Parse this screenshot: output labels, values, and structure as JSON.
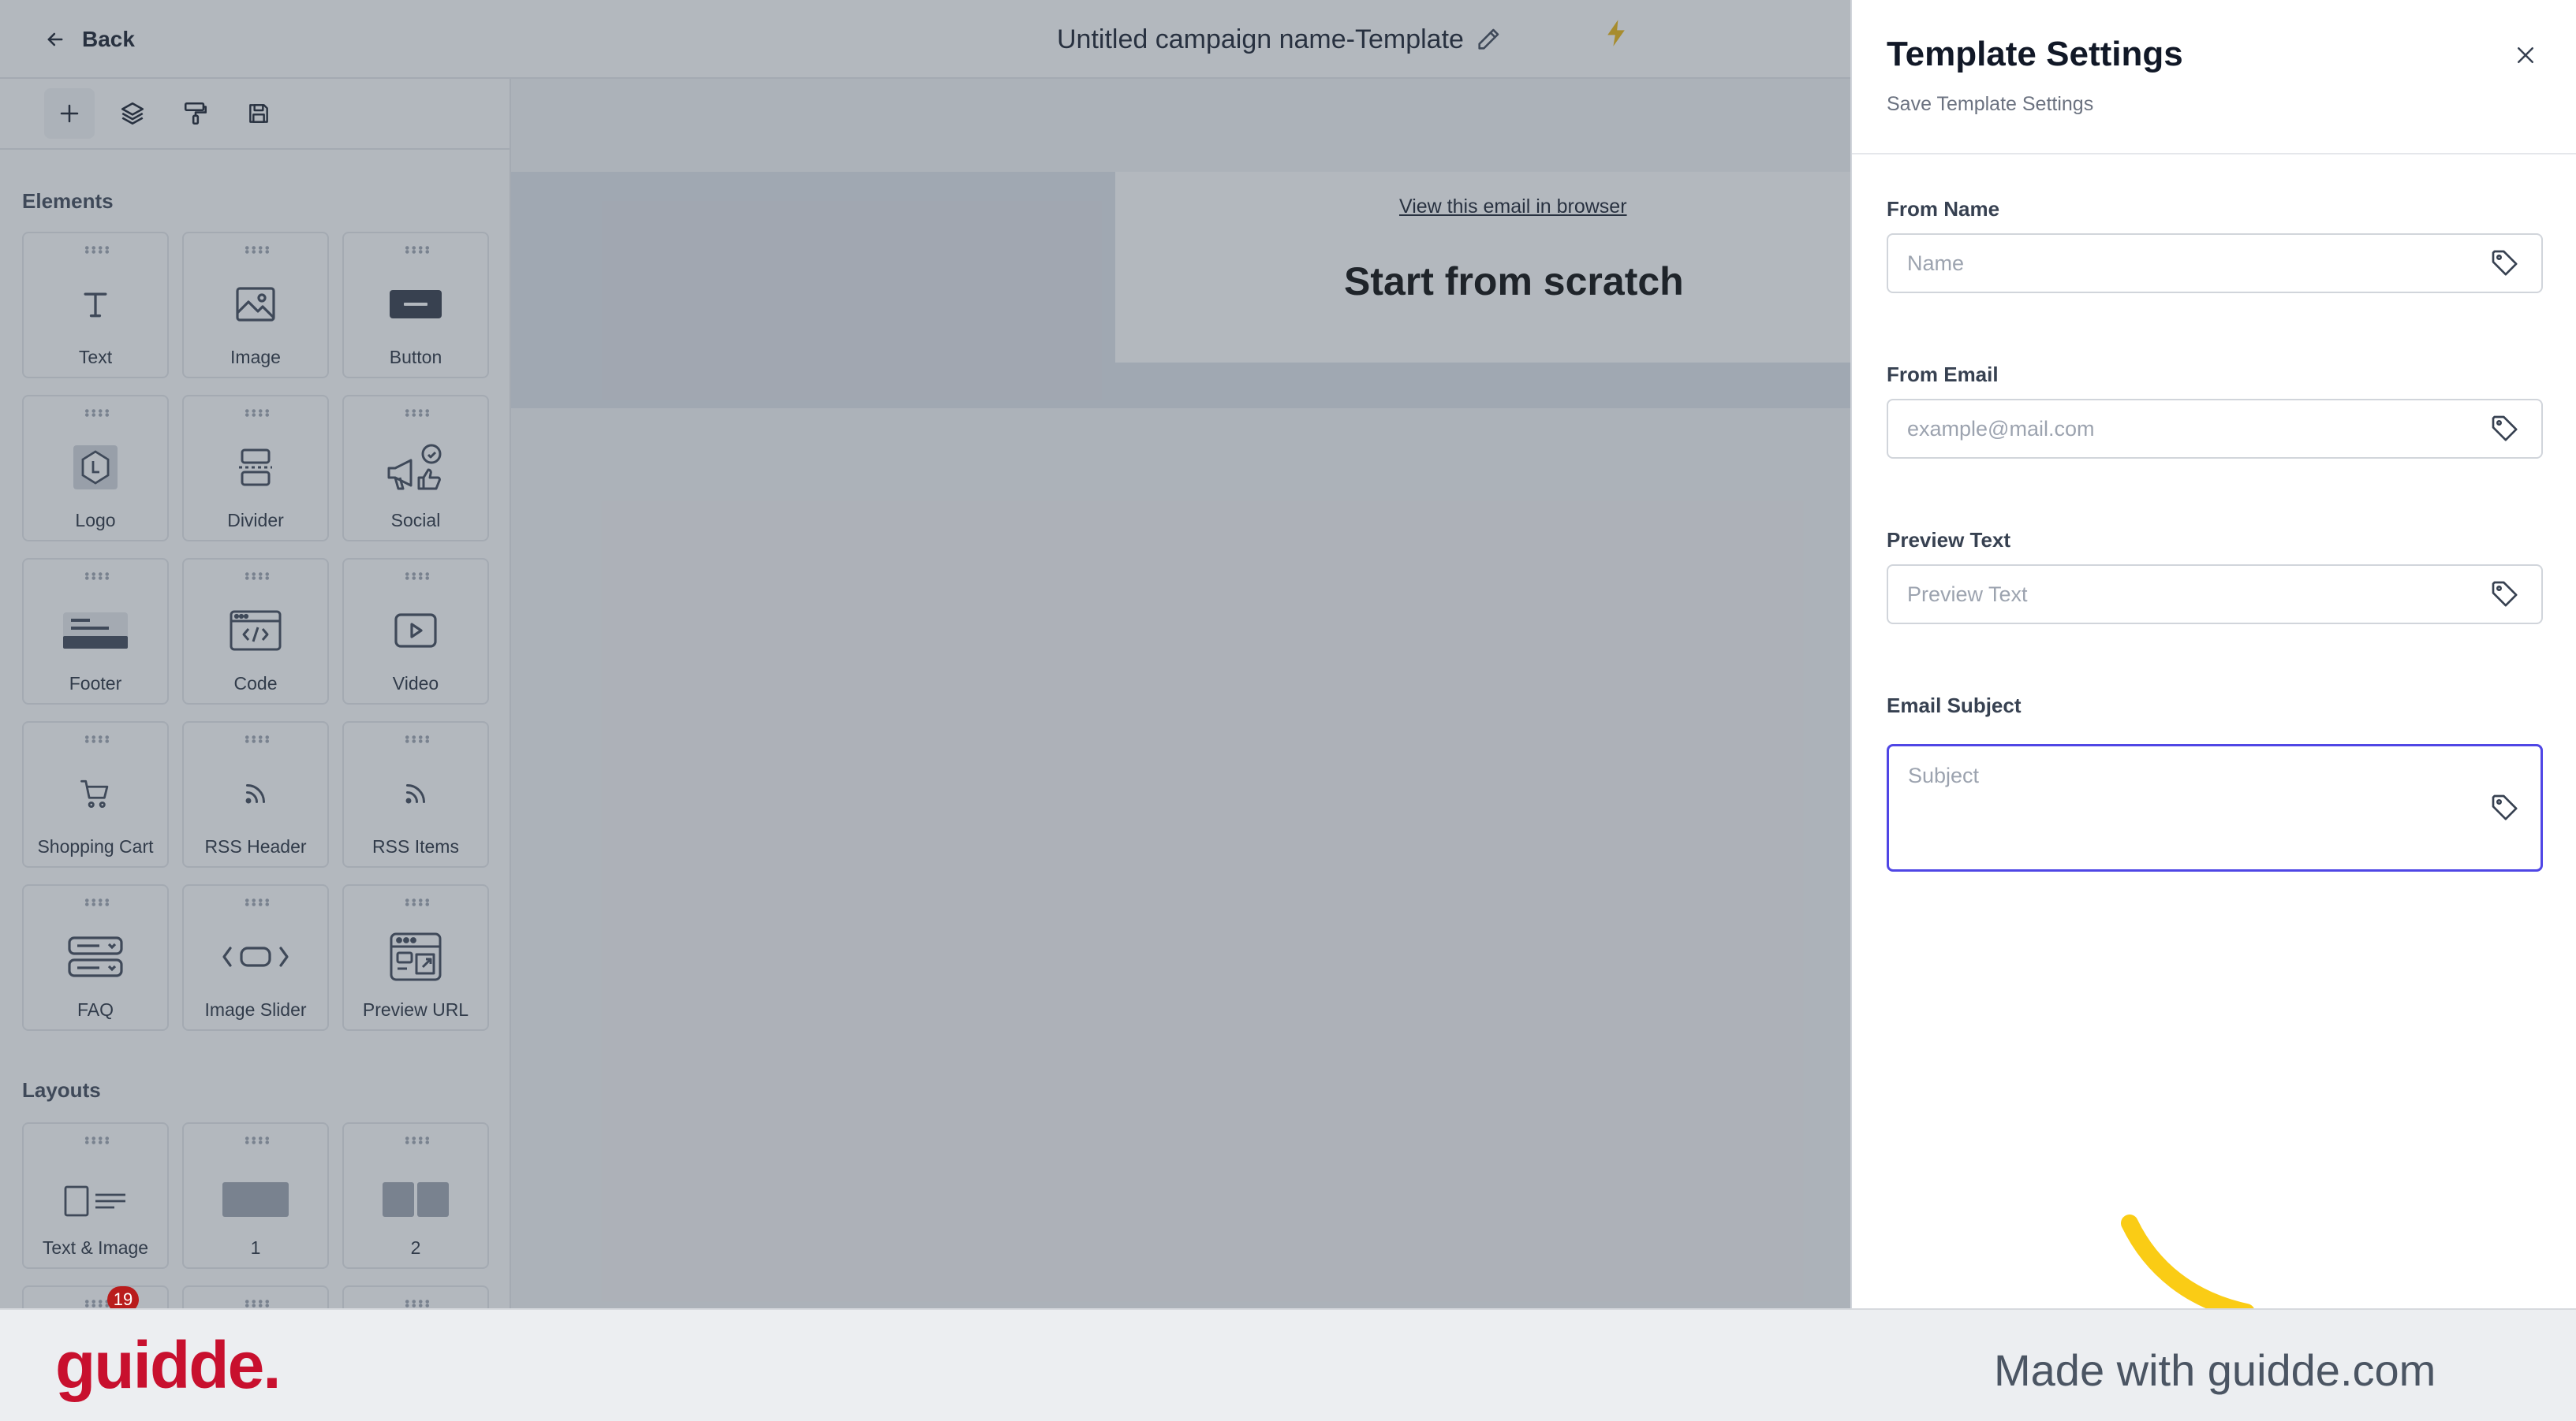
{
  "header": {
    "back_label": "Back",
    "campaign_title": "Untitled campaign name-Template"
  },
  "toolbar": {
    "tools": [
      "add-icon",
      "layers-icon",
      "paint-roller-icon",
      "save-icon"
    ]
  },
  "sidebar": {
    "elements_title": "Elements",
    "elements": [
      {
        "label": "Text",
        "icon": "text-icon"
      },
      {
        "label": "Image",
        "icon": "image-icon"
      },
      {
        "label": "Button",
        "icon": "button-icon"
      },
      {
        "label": "Logo",
        "icon": "logo-icon"
      },
      {
        "label": "Divider",
        "icon": "divider-icon"
      },
      {
        "label": "Social",
        "icon": "social-icon"
      },
      {
        "label": "Footer",
        "icon": "footer-icon"
      },
      {
        "label": "Code",
        "icon": "code-icon"
      },
      {
        "label": "Video",
        "icon": "video-icon"
      },
      {
        "label": "Shopping Cart",
        "icon": "cart-icon"
      },
      {
        "label": "RSS Header",
        "icon": "rss-icon"
      },
      {
        "label": "RSS Items",
        "icon": "rss-icon"
      },
      {
        "label": "FAQ",
        "icon": "faq-icon"
      },
      {
        "label": "Image Slider",
        "icon": "slider-icon"
      },
      {
        "label": "Preview URL",
        "icon": "preview-url-icon"
      }
    ],
    "layouts_title": "Layouts",
    "layouts": [
      {
        "label": "Text & Image",
        "icon": "text-image-layout-icon"
      },
      {
        "label": "1",
        "icon": "one-column-layout-icon"
      },
      {
        "label": "2",
        "icon": "two-column-layout-icon"
      }
    ],
    "notification_count": "19"
  },
  "canvas": {
    "view_in_browser": "View this email in browser",
    "heading": "Start from scratch"
  },
  "settings": {
    "title": "Template Settings",
    "subtitle": "Save Template Settings",
    "fields": [
      {
        "label": "From Name",
        "placeholder": "Name"
      },
      {
        "label": "From Email",
        "placeholder": "example@mail.com"
      },
      {
        "label": "Preview Text",
        "placeholder": "Preview Text"
      },
      {
        "label": "Email Subject",
        "placeholder": "Subject"
      }
    ]
  },
  "footer": {
    "logo": "guidde.",
    "tagline": "Made with guidde.com"
  }
}
